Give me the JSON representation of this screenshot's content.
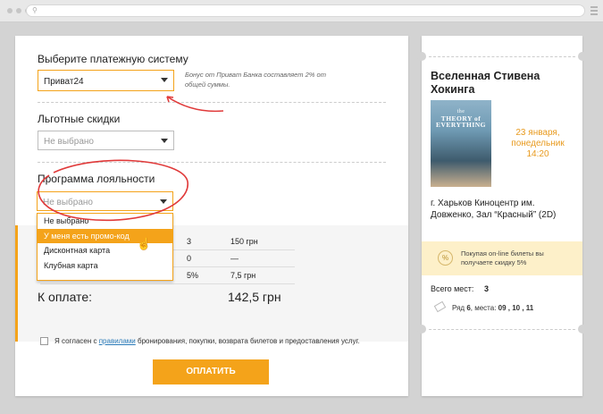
{
  "payment": {
    "title": "Выберите платежную систему",
    "selected": "Приват24",
    "bonus_note": "Бонус от Приват Банка составляет 2% от общей суммы."
  },
  "discounts": {
    "title": "Льготные скидки",
    "selected": "Не выбрано"
  },
  "loyalty": {
    "title": "Программа лояльности",
    "selected": "Не выбрано",
    "options": [
      "Не выбрано",
      "У меня есть промо-код",
      "Дисконтная карта",
      "Клубная карта"
    ]
  },
  "summary": {
    "rows": [
      {
        "qty": "3",
        "amount": "150 грн"
      },
      {
        "qty": "0",
        "amount": "—"
      },
      {
        "qty": "5%",
        "amount": "7,5 грн"
      }
    ],
    "total_label": "К оплате:",
    "total_value": "142,5 грн"
  },
  "agreement": {
    "prefix": "Я согласен с ",
    "link": "правилами",
    "suffix": " бронирования, покупки, возврата билетов и предоставления услуг."
  },
  "pay_button": "ОПЛАТИТЬ",
  "ticket": {
    "movie_title": "Вселенная Стивена Хокинга",
    "poster_small": "the",
    "poster_big": "THEORY of EVERYTHING",
    "date": "23 января, понедельник 14:20",
    "venue": "г. Харьков Киноцентр им. Довженко, Зал “Красный” (2D)",
    "promo_icon": "%",
    "promo_text": "Покупая on-line билеты вы получаете скидку 5%",
    "seats_label": "Всего мест:",
    "seats_value": "3",
    "row_label": "Ряд",
    "row_value": "6",
    "places_label": "места:",
    "places_value": "09 , 10 , 11"
  },
  "colors": {
    "accent": "#f4a31a",
    "annotation": "#e03a3a",
    "link": "#2a7ab8"
  }
}
